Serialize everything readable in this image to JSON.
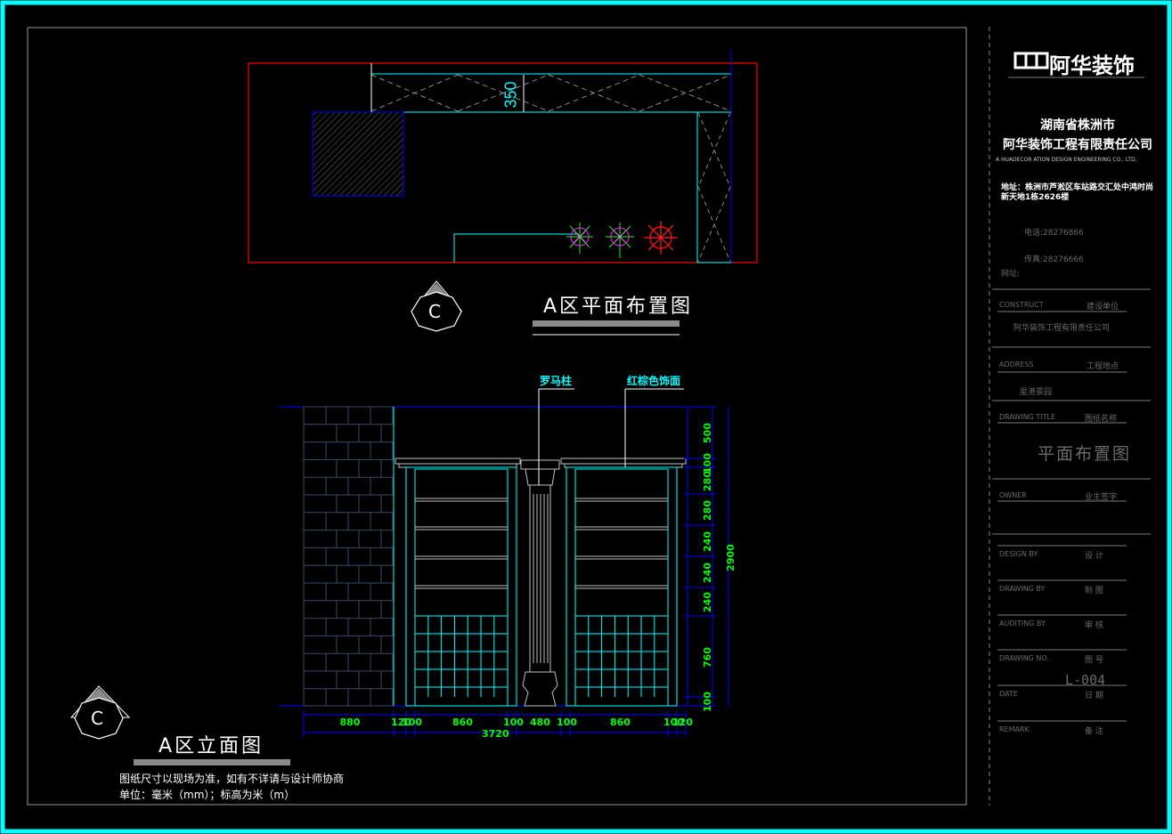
{
  "colors": {
    "border": "#00ffff",
    "plan_outline": "#ff0000",
    "dimension_text": "#00ff00",
    "dimension_line": "#0000ff",
    "annotation": "#00ffff",
    "title_white": "#ffffff",
    "brick": "#3a4a6a"
  },
  "title_block": {
    "logo_text": "阿华装饰",
    "company_line1": "湖南省株洲市",
    "company_line2": "阿华装饰工程有限责任公司",
    "company_en": "A HUADECOR ATION DESIGN ENGINEERING CO., LTD.",
    "address": "地址：株洲市芦淞区车站路交汇处中鸿时尚新天地1栋2626楼",
    "phone": "电话:28276866",
    "fax": "传真:28276666",
    "web": "网址:",
    "construct_label": "CONSTRUCT",
    "construct_cn": "建设单位",
    "construct_value": "阿华装饰工程有限责任公司",
    "address_label": "ADDRESS",
    "address_cn": "工程地点",
    "address_value": "星港景园",
    "drawing_title_label": "DRAWING  TITLE",
    "drawing_title_cn": "图纸名称",
    "drawing_title_value": "平面布置图",
    "owner_label": "OWNER",
    "owner_cn": "业主签字",
    "design_label": "DESIGN  BY",
    "design_cn": "设    计",
    "drawing_by_label": "DRAWING  BY",
    "drawing_by_cn": "制    图",
    "auditing_label": "AUDITING  BY",
    "auditing_cn": "审    核",
    "drawing_no_label": "DRAWING  NO.",
    "drawing_no_cn": "图    号",
    "drawing_no_value": "L-004",
    "date_label": "DATE",
    "date_cn": "日    期",
    "remark_label": "REMARK",
    "remark_cn": "备    注"
  },
  "plan": {
    "title": "A区平面布置图",
    "marker": "C",
    "dim_350": "350"
  },
  "elevation": {
    "title": "A区立面图",
    "marker": "C",
    "label_column": "罗马柱",
    "label_finish": "红棕色饰面",
    "vertical_dims": [
      "500",
      "100",
      "280",
      "280",
      "240",
      "240",
      "240",
      "760",
      "100"
    ],
    "total_height": "2900",
    "bottom_dims": [
      "880",
      "120",
      "100",
      "860",
      "100",
      "480",
      "100",
      "860",
      "100",
      "120"
    ],
    "total_width": "3720"
  },
  "notes": {
    "line1": "图纸尺寸以现场为准，如有不详请与设计师协商",
    "line2": "单位：毫米（mm）；标高为米（m）"
  }
}
